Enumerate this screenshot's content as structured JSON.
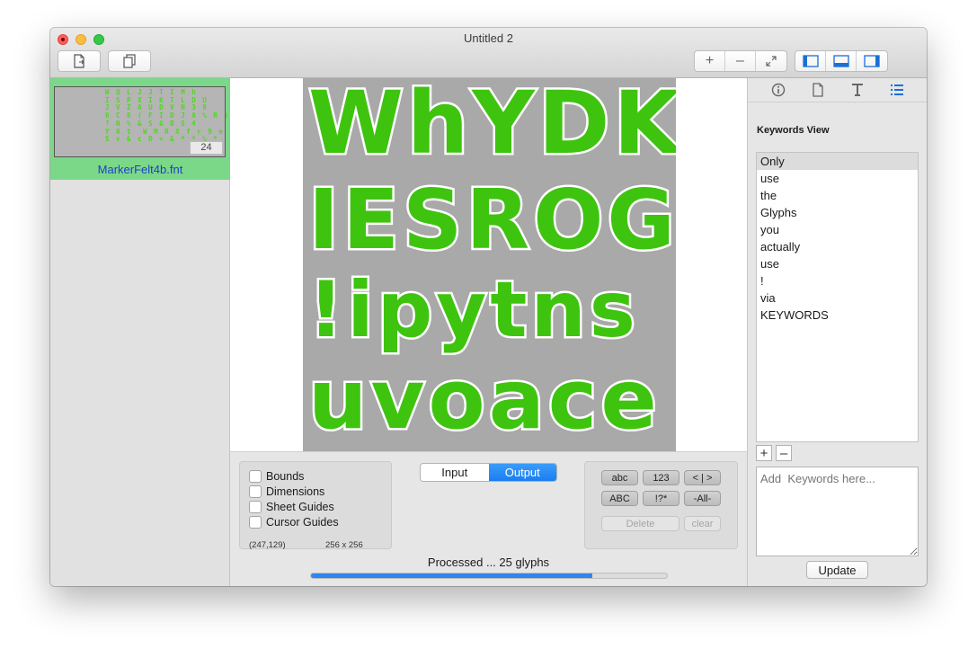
{
  "window": {
    "title": "Untitled 2"
  },
  "toolbar": {
    "new_icon": "new-document-icon",
    "duplicate_icon": "duplicate-icon",
    "zoom_in": "+",
    "zoom_out": "–",
    "fit": "expand-icon",
    "panels": [
      "left-panel-icon",
      "bottom-panel-icon",
      "right-panel-icon"
    ]
  },
  "sidebar": {
    "file": {
      "name": "MarkerFelt4b.fnt",
      "size": "24"
    },
    "thumb_text": "W Q L J J T I M h\nI S P X I K T L D U\nJ V Z A U D V N 3 9\n6 C 8 ( F I D J A % R )\n? N % & S G B S 4\nY 0 t  W M R X f r 9 e\nS v & c D < & * * % *"
  },
  "sheet": {
    "rows": [
      [
        "W",
        "h",
        "Y",
        "D",
        "K"
      ],
      [
        "I",
        "E",
        "S",
        "R",
        "O",
        "G"
      ],
      [
        "!",
        "i",
        "p",
        "y",
        "t",
        "n",
        "s"
      ],
      [
        "u",
        "v",
        "o",
        "a",
        "c",
        "e"
      ]
    ]
  },
  "guides": {
    "items": [
      "Bounds",
      "Dimensions",
      "Sheet Guides",
      "Cursor Guides"
    ],
    "coords": "(247,129)",
    "size": "256 x 256"
  },
  "view_mode": {
    "input": "Input",
    "output": "Output"
  },
  "char_buttons": {
    "abc": "abc",
    "n123": "123",
    "lt_gt": "< | >",
    "ABC": "ABC",
    "sym": "!?*",
    "all": "-All-",
    "delete": "Delete",
    "clear": "clear"
  },
  "status": {
    "text": "Processed ... 25 glyphs",
    "progress": 0.79
  },
  "inspector": {
    "tabs": [
      "info-icon",
      "document-icon",
      "text-icon",
      "list-icon"
    ],
    "title": "Keywords View",
    "keywords": [
      "Only",
      "use",
      "the",
      "Glyphs",
      "you",
      "actually",
      "use",
      "!",
      "via",
      "KEYWORDS"
    ],
    "add": "+",
    "remove": "–",
    "input_placeholder": "Add  Keywords here...",
    "update": "Update"
  },
  "colors": {
    "accent": "#1a7ef1",
    "selection": "#7bd889",
    "glyph": "#3ec40f"
  }
}
